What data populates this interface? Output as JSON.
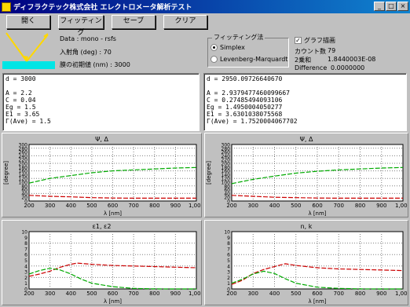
{
  "window": {
    "title": "ディフラクテック株式会社 エレクトロメータ解析テスト",
    "controls": [
      "_",
      "□",
      "×"
    ]
  },
  "toolbar": {
    "buttons": [
      {
        "label": "開く"
      },
      {
        "label": "フィッティング"
      },
      {
        "label": "セーブ"
      },
      {
        "label": "クリア"
      }
    ]
  },
  "info": {
    "line1": "Data : mono - rsfs",
    "line2": "入射角 (deg)  : 70",
    "line3": "膜の初期値 (nm)  : 3000"
  },
  "method_group": {
    "label": "フィッティング法",
    "options": [
      {
        "label": "Simplex",
        "selected": true
      },
      {
        "label": "Levenberg-Marquardt",
        "selected": false
      }
    ]
  },
  "graph_display": {
    "label": "グラフ描画",
    "checked": true,
    "count_label": "カウント数",
    "count_value": "79",
    "sum_label": "2乗和",
    "sum_value": "1.8440003E-08",
    "diff_label": "Difference",
    "diff_value": "0.0000000"
  },
  "left_text": [
    "d = 3000",
    "",
    "A = 2.2",
    "C = 0.04",
    "Eg = 1.5",
    "E1 = 3.65",
    "Γ(Ave) = 1.5"
  ],
  "right_text": [
    "d = 2950.09726640670",
    "",
    "A = 2.9379477460099667",
    "C = 0.27485494093106",
    "Eg = 1.4950004050277",
    "E1 = 3.6301038075568",
    "Γ(Ave) = 1.7520004067702"
  ],
  "charts": [
    {
      "chart_data": {
        "type": "line",
        "title": "Ψ, Δ",
        "xlabel": "λ [nm]",
        "ylabel": "[degree]",
        "xlim": [
          200,
          1000
        ],
        "ylim": [
          0,
          300
        ],
        "xticks": [
          "200",
          "300",
          "400",
          "500",
          "600",
          "700",
          "800",
          "900",
          "1,000"
        ],
        "yticks": [
          "0",
          "20",
          "40",
          "60",
          "80",
          "100",
          "120",
          "140",
          "160",
          "180",
          "200",
          "220",
          "240",
          "260",
          "280",
          "300"
        ],
        "series": [
          {
            "color": "#cc0000",
            "x": [
              200,
              300,
              400,
              500,
              600,
              700,
              800,
              900,
              1000
            ],
            "y": [
              30,
              25,
              22,
              18,
              16,
              15,
              15,
              15,
              15
            ]
          },
          {
            "color": "#00aa00",
            "x": [
              200,
              300,
              400,
              500,
              600,
              700,
              800,
              900,
              1000
            ],
            "y": [
              95,
              120,
              135,
              150,
              160,
              165,
              170,
              175,
              178
            ]
          }
        ]
      }
    },
    {
      "chart_data": {
        "type": "line",
        "title": "Ψ, Δ",
        "xlabel": "λ [nm]",
        "ylabel": "[degree]",
        "xlim": [
          200,
          1000
        ],
        "ylim": [
          0,
          300
        ],
        "xticks": [
          "200",
          "300",
          "400",
          "500",
          "600",
          "700",
          "800",
          "900",
          "1,000"
        ],
        "yticks": [
          "0",
          "20",
          "40",
          "60",
          "80",
          "100",
          "120",
          "140",
          "160",
          "180",
          "200",
          "220",
          "240",
          "260",
          "280",
          "300"
        ],
        "series": [
          {
            "color": "#cc0000",
            "x": [
              200,
              300,
              400,
              500,
              600,
              700,
              800,
              900,
              1000
            ],
            "y": [
              30,
              25,
              20,
              18,
              16,
              15,
              15,
              15,
              15
            ]
          },
          {
            "color": "#00aa00",
            "x": [
              200,
              300,
              400,
              500,
              600,
              700,
              800,
              900,
              1000
            ],
            "y": [
              92,
              115,
              132,
              148,
              158,
              165,
              170,
              175,
              178
            ]
          }
        ]
      }
    },
    {
      "chart_data": {
        "type": "line",
        "title": "ε1, ε2",
        "xlabel": "λ [nm]",
        "ylabel": "",
        "xlim": [
          200,
          1000
        ],
        "ylim": [
          0,
          10
        ],
        "xticks": [
          "200",
          "300",
          "400",
          "500",
          "600",
          "700",
          "800",
          "900",
          "1,000"
        ],
        "yticks": [
          "0",
          "1",
          "2",
          "3",
          "4",
          "5",
          "6",
          "7",
          "8",
          "9",
          "10"
        ],
        "series": [
          {
            "color": "#cc0000",
            "x": [
              200,
              250,
              300,
              350,
              400,
              430,
              500,
              600,
              700,
              800,
              900,
              1000
            ],
            "y": [
              2.2,
              2.6,
              3.1,
              3.8,
              4.3,
              4.5,
              4.3,
              4.1,
              4.0,
              3.9,
              3.8,
              3.7
            ]
          },
          {
            "color": "#00aa00",
            "x": [
              200,
              250,
              300,
              350,
              400,
              450,
              500,
              600,
              700,
              800,
              900,
              1000
            ],
            "y": [
              2.6,
              3.2,
              3.6,
              3.3,
              2.6,
              1.7,
              1.0,
              0.4,
              0.1,
              0.02,
              0,
              0
            ]
          }
        ]
      }
    },
    {
      "chart_data": {
        "type": "line",
        "title": "n, k",
        "xlabel": "λ [nm]",
        "ylabel": "",
        "xlim": [
          200,
          1000
        ],
        "ylim": [
          0,
          10
        ],
        "xticks": [
          "200",
          "300",
          "400",
          "500",
          "600",
          "700",
          "800",
          "900",
          "1,000"
        ],
        "yticks": [
          "0",
          "1",
          "2",
          "3",
          "4",
          "5",
          "6",
          "7",
          "8",
          "9",
          "10"
        ],
        "series": [
          {
            "color": "#cc0000",
            "x": [
              200,
              250,
              300,
              350,
              400,
              450,
              500,
              600,
              700,
              800,
              900,
              1000
            ],
            "y": [
              0.8,
              1.5,
              2.7,
              3.4,
              3.9,
              4.4,
              4.1,
              3.7,
              3.5,
              3.4,
              3.3,
              3.2
            ]
          },
          {
            "color": "#00aa00",
            "x": [
              200,
              250,
              300,
              350,
              400,
              450,
              500,
              600,
              700,
              800,
              900,
              1000
            ],
            "y": [
              1.0,
              1.7,
              2.6,
              3.1,
              2.7,
              1.8,
              1.0,
              0.3,
              0.1,
              0.02,
              0,
              0
            ]
          }
        ]
      }
    }
  ]
}
